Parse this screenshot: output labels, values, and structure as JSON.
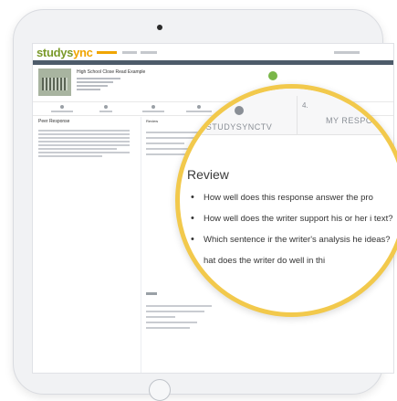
{
  "brand": {
    "logo_part1": "studys",
    "logo_part2": "ync",
    "accent": "#f2c94c",
    "green": "#7ab648"
  },
  "assignment": {
    "title": "High School Close Read Example"
  },
  "left_panel": {
    "title": "Peer Response"
  },
  "mini_review": {
    "title": "Review"
  },
  "magnified": {
    "tab_studysync": "STUDYSYNCTV",
    "tab_number": "4.",
    "tab_response": "MY RESPO",
    "review_title": "Review",
    "questions": [
      "How well does this response answer the pro",
      "How well does the writer support his or her i text?",
      "Which sentence ir the writer's analysis he ideas?",
      "hat does the writer do well in thi"
    ]
  }
}
